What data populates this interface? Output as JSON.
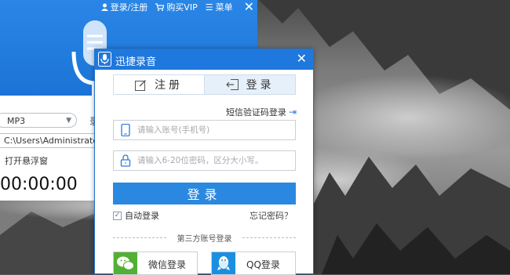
{
  "recorder": {
    "top_links": {
      "login_register": "登录/注册",
      "buy_vip": "购买VIP",
      "menu": "菜单"
    },
    "format_value": "MP3",
    "format_side": "录",
    "save_path": "C:\\Users\\Administrator\\Desk",
    "floating_window": "打开悬浮窗",
    "timer": "00:00:00"
  },
  "dialog": {
    "title": "迅捷录音",
    "tabs": [
      {
        "label": "注册",
        "active": false
      },
      {
        "label": "登录",
        "active": true
      }
    ],
    "sms_login": "短信验证码登录",
    "account_placeholder": "请输入账号(手机号)",
    "password_placeholder": "请输入6-20位密码，区分大小写。",
    "login_button": "登录",
    "auto_login": "自动登录",
    "auto_login_checked": true,
    "forgot_password": "忘记密码？",
    "third_party": "第三方账号登录",
    "wechat_login": "微信登录",
    "qq_login": "QQ登录"
  },
  "colors": {
    "brand_blue": "#1f78dd",
    "button_blue": "#2b88e0",
    "wechat_green": "#52b034",
    "qq_blue": "#1a8fe0"
  }
}
